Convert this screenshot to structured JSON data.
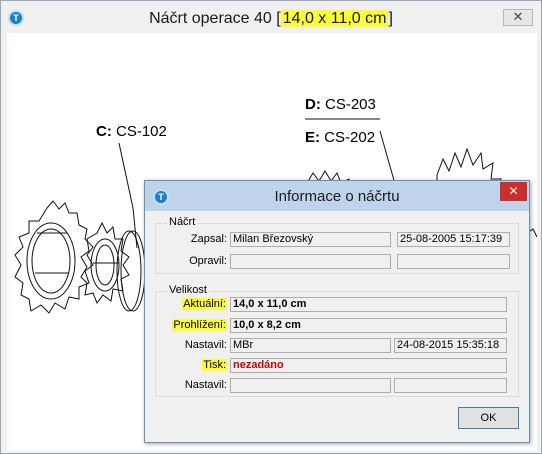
{
  "outer_window": {
    "app_icon": "T",
    "title_prefix": "Náčrt operace 40 [",
    "title_size": "14,0 x 11,0 cm",
    "title_suffix": "]",
    "close_glyph": "✕"
  },
  "drawing": {
    "label_c": "C:",
    "label_c_value": "CS-102",
    "label_d": "D:",
    "label_d_value": "CS-203",
    "label_e": "E:",
    "label_e_value": "CS-202"
  },
  "dialog": {
    "app_icon": "T",
    "title": "Informace o náčrtu",
    "close_glyph": "✕",
    "group_sketch": {
      "label": "Náčrt",
      "written_by_label": "Zapsal:",
      "written_by_value": "Milan Březovský",
      "written_at": "25-08-2005 15:17:39",
      "edited_by_label": "Opravil:",
      "edited_by_value": "",
      "edited_at": ""
    },
    "group_size": {
      "label": "Velikost",
      "current_label": "Aktuální:",
      "current_value": "14,0 x 11,0 cm",
      "preview_label": "Prohlížení:",
      "preview_value": "10,0 x 8,2 cm",
      "set_by_label": "Nastavil:",
      "set_by_value": "MBr",
      "set_at": "24-08-2015 15:35:18",
      "print_label": "Tisk:",
      "print_value": "nezadáno",
      "print_set_by_label": "Nastavil:",
      "print_set_by_value": "",
      "print_set_at": ""
    },
    "ok_label": "OK"
  }
}
